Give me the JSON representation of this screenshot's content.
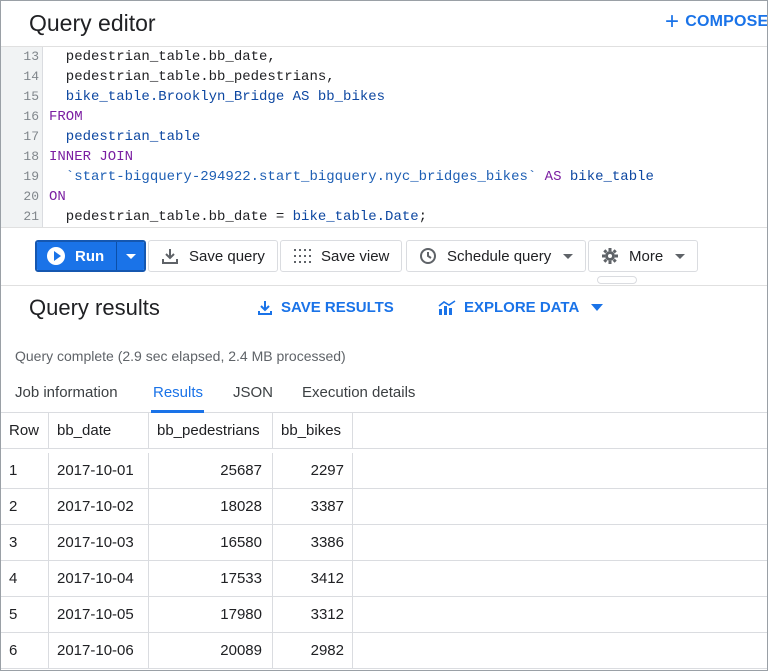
{
  "editor": {
    "title": "Query editor",
    "compose_label": "COMPOSE",
    "code_lines": [
      {
        "num": "13",
        "segments": [
          {
            "text": "  pedestrian_table.bb_date,",
            "type": "plain"
          }
        ]
      },
      {
        "num": "14",
        "segments": [
          {
            "text": "  pedestrian_table.bb_pedestrians,",
            "type": "plain"
          }
        ]
      },
      {
        "num": "15",
        "segments": [
          {
            "text": "  bike_table.Brooklyn_Bridge AS bb_bikes",
            "type": "fn"
          }
        ]
      },
      {
        "num": "16",
        "segments": [
          {
            "text": "FROM",
            "type": "kw"
          }
        ]
      },
      {
        "num": "17",
        "segments": [
          {
            "text": "  pedestrian_table",
            "type": "fn"
          }
        ]
      },
      {
        "num": "18",
        "segments": [
          {
            "text": "INNER JOIN",
            "type": "kw"
          }
        ]
      },
      {
        "num": "19",
        "segments": [
          {
            "text": "  `start-bigquery-294922.start_bigquery.nyc_bridges_bikes`",
            "type": "str"
          },
          {
            "text": " AS ",
            "type": "kw"
          },
          {
            "text": "bike_table",
            "type": "fn"
          }
        ]
      },
      {
        "num": "20",
        "segments": [
          {
            "text": "ON",
            "type": "kw"
          }
        ]
      },
      {
        "num": "21",
        "segments": [
          {
            "text": "  pedestrian_table.bb_date = ",
            "type": "plain"
          },
          {
            "text": "bike_table.Date",
            "type": "fn"
          },
          {
            "text": ";",
            "type": "plain"
          }
        ]
      }
    ]
  },
  "toolbar": {
    "run_label": "Run",
    "save_query_label": "Save query",
    "save_view_label": "Save view",
    "schedule_query_label": "Schedule query",
    "more_label": "More"
  },
  "results": {
    "title": "Query results",
    "save_results_label": "SAVE RESULTS",
    "explore_data_label": "EXPLORE DATA",
    "status": "Query complete (2.9 sec elapsed, 2.4 MB processed)",
    "tabs": [
      "Job information",
      "Results",
      "JSON",
      "Execution details"
    ],
    "active_tab": "Results",
    "columns": [
      "Row",
      "bb_date",
      "bb_pedestrians",
      "bb_bikes"
    ],
    "rows": [
      [
        "1",
        "2017-10-01",
        "25687",
        "2297"
      ],
      [
        "2",
        "2017-10-02",
        "18028",
        "3387"
      ],
      [
        "3",
        "2017-10-03",
        "16580",
        "3386"
      ],
      [
        "4",
        "2017-10-04",
        "17533",
        "3412"
      ],
      [
        "5",
        "2017-10-05",
        "17980",
        "3312"
      ],
      [
        "6",
        "2017-10-06",
        "20089",
        "2982"
      ]
    ]
  },
  "colors": {
    "accent": "#1a73e8",
    "keyword": "#7b1fa2",
    "identifier": "#0d47a1"
  }
}
